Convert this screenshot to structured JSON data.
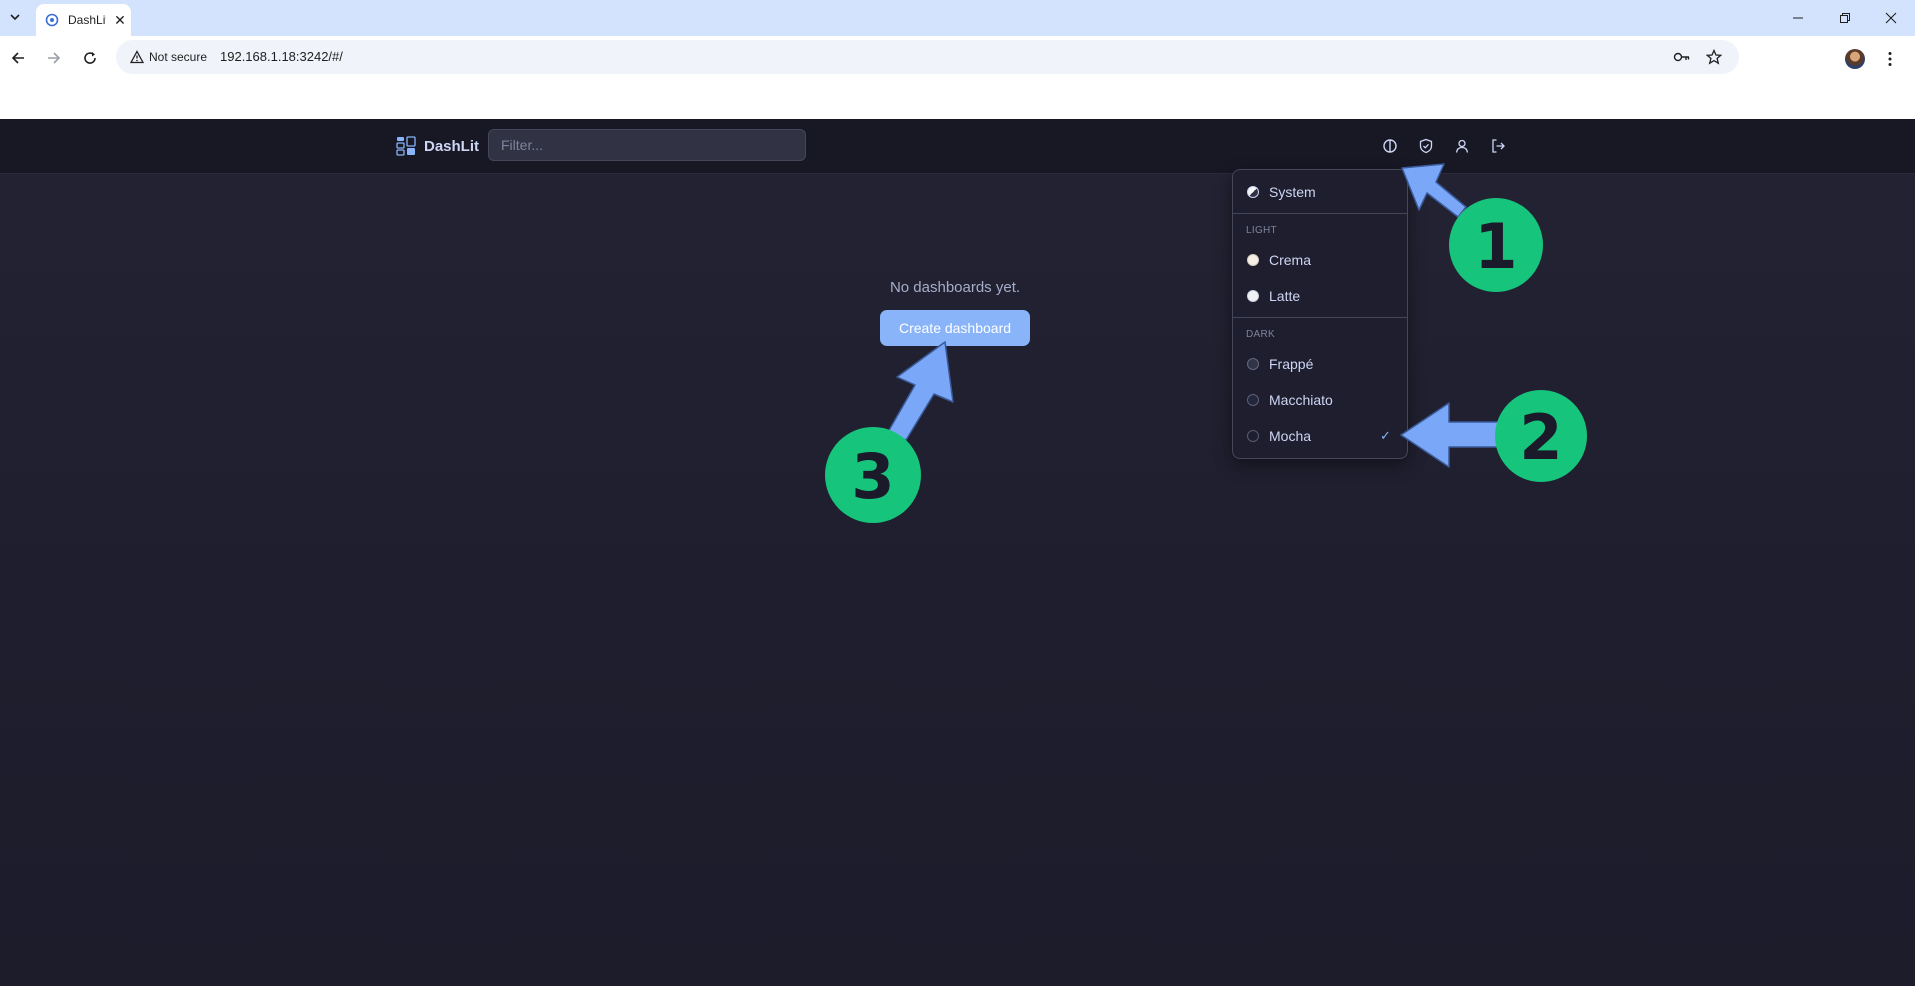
{
  "browser": {
    "tab_title": "DashLit",
    "not_secure_label": "Not secure",
    "url": "192.168.1.18:3242/#/"
  },
  "app": {
    "brand": "DashLit",
    "filter_placeholder": "Filter...",
    "empty_message": "No dashboards yet.",
    "create_button": "Create dashboard"
  },
  "theme_menu": {
    "system_label": "System",
    "light_section": "LIGHT",
    "dark_section": "DARK",
    "light_items": [
      "Crema",
      "Latte"
    ],
    "dark_items": [
      "Frappé",
      "Macchiato",
      "Mocha"
    ],
    "selected": "Mocha",
    "check_mark": "✓"
  },
  "annotations": {
    "labels": [
      "1",
      "2",
      "3"
    ],
    "arrow_color": "#7aa7f7",
    "badge_color": "#17c47c"
  },
  "colors": {
    "accent": "#89b4fa",
    "background": "#1e1e2e",
    "header": "#181825",
    "text": "#cdd6f4"
  }
}
